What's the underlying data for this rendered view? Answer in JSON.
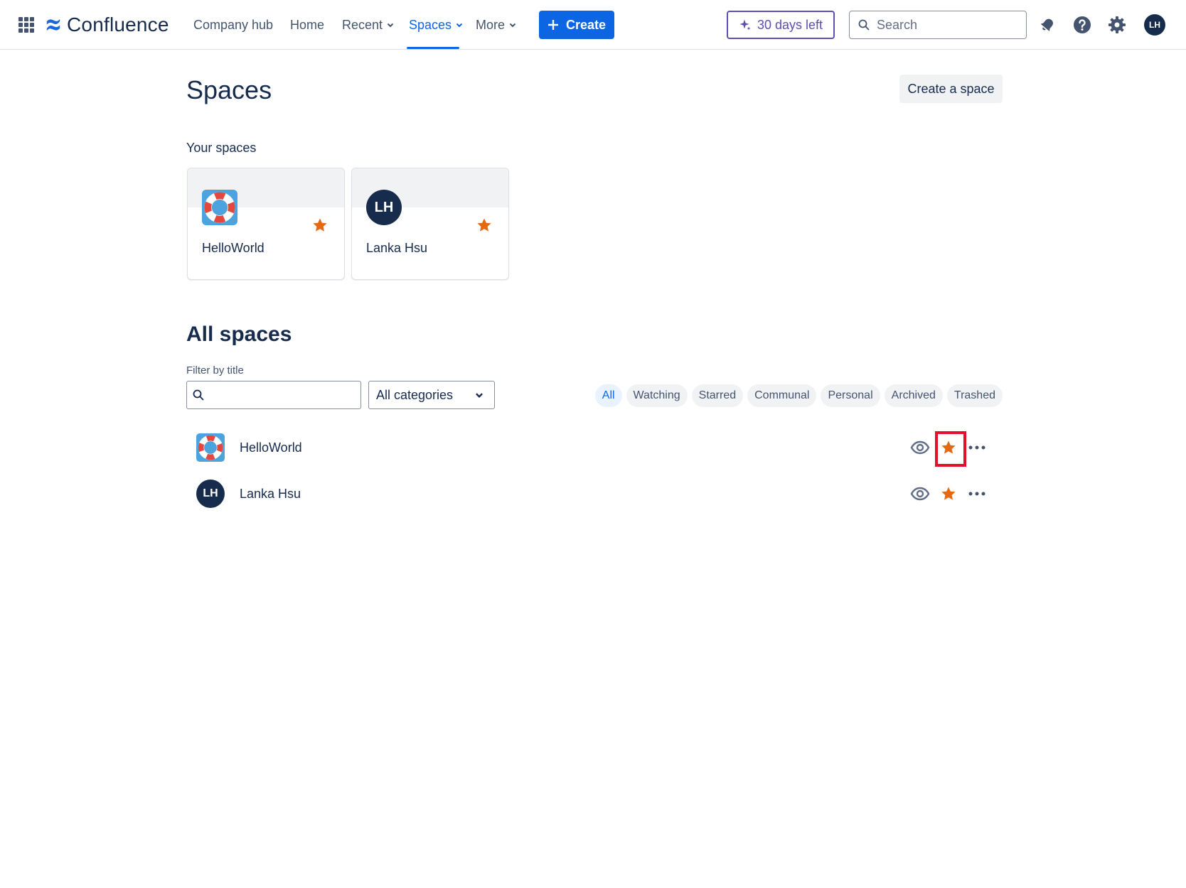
{
  "topnav": {
    "app_name": "Confluence",
    "items": [
      {
        "label": "Company hub"
      },
      {
        "label": "Home"
      },
      {
        "label": "Recent"
      },
      {
        "label": "Spaces"
      },
      {
        "label": "More"
      }
    ],
    "active_item": "Spaces",
    "create_label": "Create",
    "trial_label": "30 days left",
    "search_placeholder": "Search",
    "user_initials": "LH",
    "icons": [
      "app-switcher-icon",
      "confluence-logo-icon",
      "notifications-icon",
      "help-icon",
      "settings-icon"
    ]
  },
  "page": {
    "title": "Spaces",
    "create_space_label": "Create a space",
    "your_spaces_label": "Your spaces",
    "your_spaces": [
      {
        "name": "HelloWorld",
        "icon": "lifebuoy-icon",
        "starred": true
      },
      {
        "name": "Lanka Hsu",
        "initials": "LH",
        "starred": true
      }
    ],
    "all_spaces_title": "All spaces",
    "filter_label": "Filter by title",
    "filter_value": "",
    "category_select": "All categories",
    "filter_chips": [
      "All",
      "Watching",
      "Starred",
      "Communal",
      "Personal",
      "Archived",
      "Trashed"
    ],
    "selected_chip": "All",
    "all_spaces": [
      {
        "name": "HelloWorld",
        "icon": "lifebuoy-icon",
        "starred": true,
        "watching": true
      },
      {
        "name": "Lanka Hsu",
        "initials": "LH",
        "starred": true,
        "watching": true
      }
    ]
  },
  "colors": {
    "primary": "#0c66e4",
    "star": "#e56910",
    "trial": "#5e4db2",
    "highlight": "#e2102b",
    "avatar": "#172b4d"
  }
}
